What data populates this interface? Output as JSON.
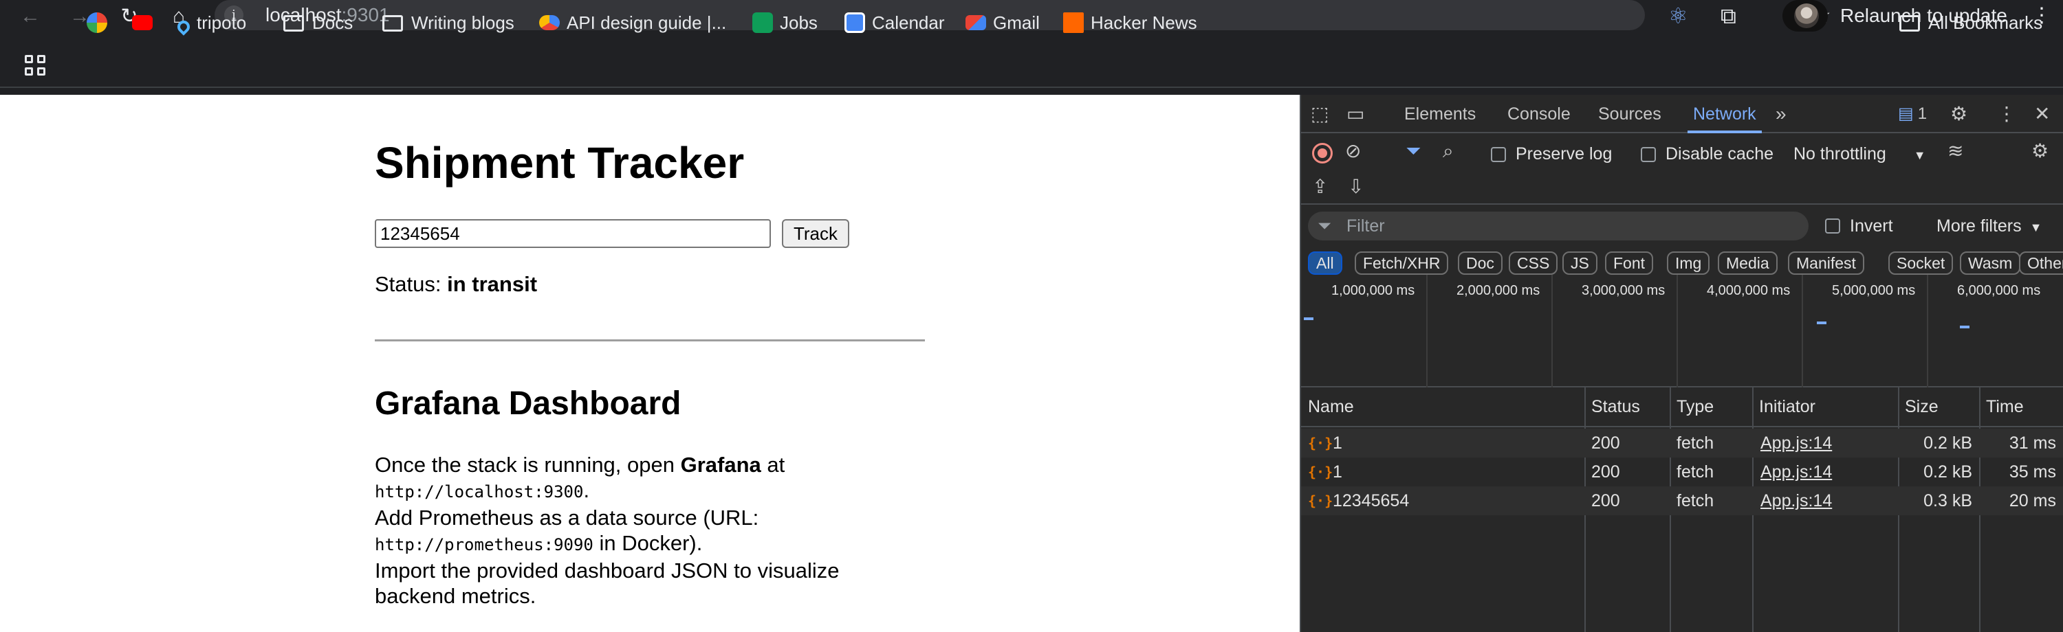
{
  "browser": {
    "url_host": "localhost",
    "url_port": ":9301",
    "relaunch_label": "Relaunch to update"
  },
  "bookmarks": {
    "items": [
      {
        "label": "",
        "icon": "google-icon"
      },
      {
        "label": "",
        "icon": "youtube-icon"
      },
      {
        "label": "tripoto",
        "icon": "location-pin-icon"
      },
      {
        "label": "Docs",
        "icon": "folder-icon"
      },
      {
        "label": "Writing blogs",
        "icon": "folder-icon"
      },
      {
        "label": "API design guide  |...",
        "icon": "google-cloud-icon"
      },
      {
        "label": "Jobs",
        "icon": "sheets-icon"
      },
      {
        "label": "Calendar",
        "icon": "calendar-icon"
      },
      {
        "label": "Gmail",
        "icon": "gmail-icon"
      },
      {
        "label": "Hacker News",
        "icon": "hacker-news-icon"
      }
    ],
    "all_bookmarks": "All Bookmarks"
  },
  "page": {
    "title": "Shipment Tracker",
    "tracking_value": "12345654",
    "track_button": "Track",
    "status_label": "Status: ",
    "status_value": "in transit",
    "grafana_title": "Grafana Dashboard",
    "p1_a": "Once the stack is running, open ",
    "p1_b": "Grafana",
    "p1_c": " at",
    "p1_code": "http://localhost:9300",
    "p1_d": ".",
    "p2_a": "Add Prometheus as a data source (URL:",
    "p2_code": "http://prometheus:9090",
    "p2_b": " in Docker).",
    "p3": "Import the provided dashboard JSON to visualize backend metrics."
  },
  "devtools": {
    "tabs": [
      "Elements",
      "Console",
      "Sources",
      "Network"
    ],
    "active_tab": "Network",
    "issues_count": "1",
    "preserve_log": "Preserve log",
    "disable_cache": "Disable cache",
    "throttling": "No throttling",
    "filter_placeholder": "Filter",
    "invert": "Invert",
    "more_filters": "More filters",
    "types": [
      "All",
      "Fetch/XHR",
      "Doc",
      "CSS",
      "JS",
      "Font",
      "Img",
      "Media",
      "Manifest",
      "Socket",
      "Wasm",
      "Other"
    ],
    "timeline_ticks": [
      "1,000,000 ms",
      "2,000,000 ms",
      "3,000,000 ms",
      "4,000,000 ms",
      "5,000,000 ms",
      "6,000,000 ms"
    ],
    "columns": [
      "Name",
      "Status",
      "Type",
      "Initiator",
      "Size",
      "Time"
    ],
    "rows": [
      {
        "name": "1",
        "status": "200",
        "type": "fetch",
        "initiator": "App.js:14",
        "size": "0.2 kB",
        "time": "31 ms"
      },
      {
        "name": "1",
        "status": "200",
        "type": "fetch",
        "initiator": "App.js:14",
        "size": "0.2 kB",
        "time": "35 ms"
      },
      {
        "name": "12345654",
        "status": "200",
        "type": "fetch",
        "initiator": "App.js:14",
        "size": "0.3 kB",
        "time": "20 ms"
      }
    ]
  },
  "colors": {
    "accent": "#7cacf8",
    "record": "#f28b82",
    "fetch_icon": "#e37400"
  }
}
